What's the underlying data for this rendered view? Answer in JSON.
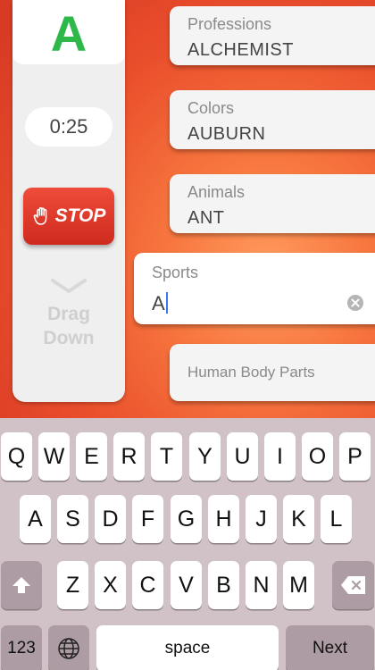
{
  "game": {
    "letter": "A",
    "timer": "0:25",
    "stop_label": "STOP",
    "drag_hint_line1": "Drag",
    "drag_hint_line2": "Down"
  },
  "categories": [
    {
      "name": "Professions",
      "answer": "ALCHEMIST"
    },
    {
      "name": "Colors",
      "answer": "AUBURN"
    },
    {
      "name": "Animals",
      "answer": "ANT"
    },
    {
      "name": "Sports",
      "answer": "A"
    },
    {
      "name": "Human Body Parts",
      "answer": ""
    }
  ],
  "colors": {
    "letter": "#2fb84a",
    "stop_button": "#e03a2c",
    "caret": "#3478f6"
  },
  "keyboard": {
    "row1": [
      "Q",
      "W",
      "E",
      "R",
      "T",
      "Y",
      "U",
      "I",
      "O",
      "P"
    ],
    "row2": [
      "A",
      "S",
      "D",
      "F",
      "G",
      "H",
      "J",
      "K",
      "L"
    ],
    "row3": [
      "Z",
      "X",
      "C",
      "V",
      "B",
      "N",
      "M"
    ],
    "numbers_key": "123",
    "space_key": "space",
    "next_key": "Next",
    "icons": [
      "shift-icon",
      "backspace-icon",
      "globe-icon"
    ]
  }
}
